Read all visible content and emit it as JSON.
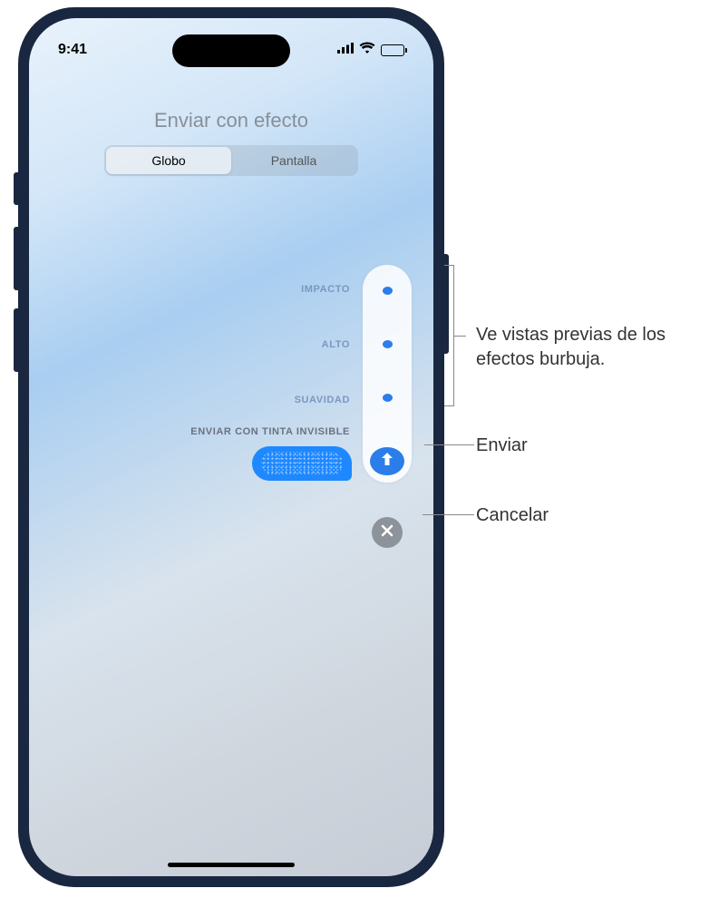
{
  "statusBar": {
    "time": "9:41"
  },
  "title": "Enviar con efecto",
  "tabs": {
    "bubble": "Globo",
    "screen": "Pantalla"
  },
  "effects": {
    "impact": "IMPACTO",
    "loud": "ALTO",
    "gentle": "SUAVIDAD",
    "invisibleInk": "ENVIAR CON TINTA INVISIBLE"
  },
  "callouts": {
    "preview": "Ve vistas previas de los efectos burbuja.",
    "send": "Enviar",
    "cancel": "Cancelar"
  }
}
